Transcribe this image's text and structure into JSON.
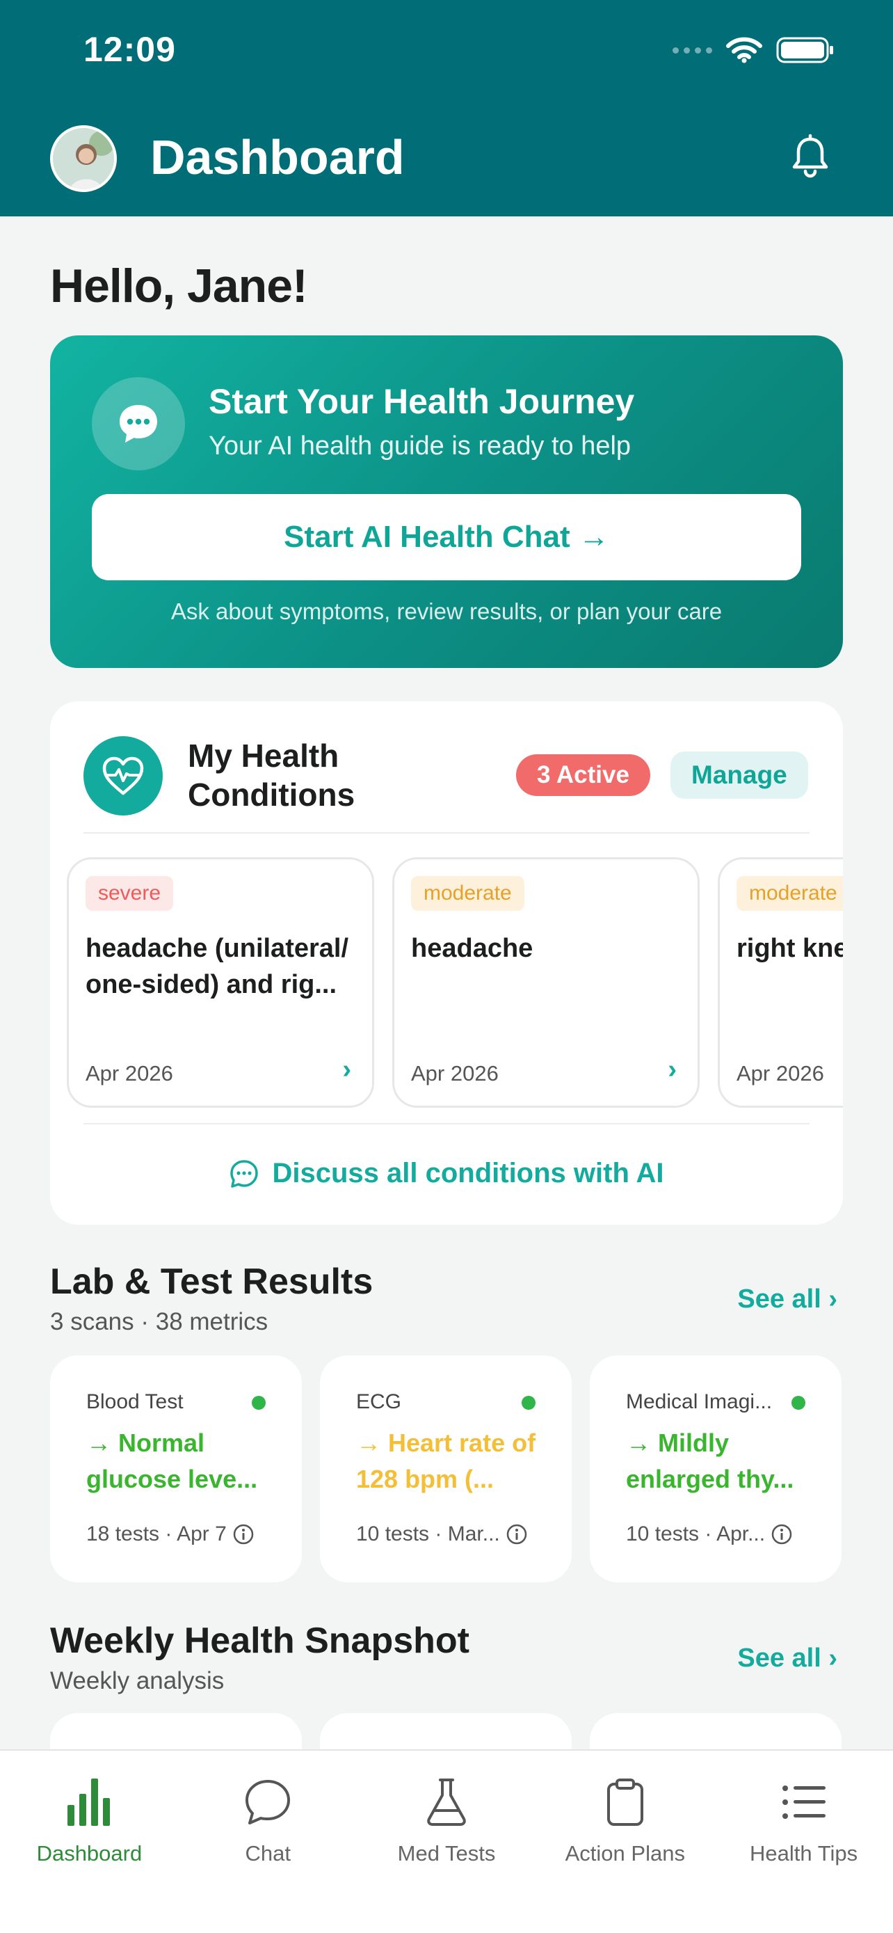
{
  "status_bar": {
    "time": "12:09"
  },
  "header": {
    "title": "Dashboard"
  },
  "greeting": "Hello, Jane!",
  "hero": {
    "title": "Start Your Health Journey",
    "subtitle": "Your AI health guide is ready to help",
    "button_label": "Start AI Health Chat →",
    "note": "Ask about symptoms, review results, or plan your care"
  },
  "conditions": {
    "title": "My Health Conditions",
    "active_badge": "3 Active",
    "manage_label": "Manage",
    "items": [
      {
        "severity": "severe",
        "name": "headache (unilateral/ one-sided) and rig...",
        "date": "Apr 2026"
      },
      {
        "severity": "moderate",
        "name": "headache",
        "date": "Apr 2026"
      },
      {
        "severity": "moderate",
        "name": "right knee",
        "date": "Apr 2026"
      }
    ],
    "discuss_label": "Discuss all conditions with AI"
  },
  "labs": {
    "title": "Lab & Test Results",
    "subtitle": "3 scans · 38 metrics",
    "see_all": "See all",
    "items": [
      {
        "category": "Blood Test",
        "result": "→ Normal glucose leve...",
        "meta": "18 tests · Apr 7",
        "color": "#3ab52e"
      },
      {
        "category": "ECG",
        "result": "→ Heart rate of 128 bpm (...",
        "meta": "10 tests · Mar...",
        "color": "#f4bf36"
      },
      {
        "category": "Medical Imagi...",
        "result": "→ Mildly enlarged thy...",
        "meta": "10 tests · Apr...",
        "color": "#3ab52e"
      }
    ]
  },
  "snapshot": {
    "title": "Weekly Health Snapshot",
    "subtitle": "Weekly analysis",
    "see_all": "See all"
  },
  "tabbar": {
    "items": [
      {
        "label": "Dashboard",
        "icon": "bar-chart-icon",
        "active": true
      },
      {
        "label": "Chat",
        "icon": "chat-bubble-icon",
        "active": false
      },
      {
        "label": "Med Tests",
        "icon": "flask-icon",
        "active": false
      },
      {
        "label": "Action Plans",
        "icon": "clipboard-icon",
        "active": false
      },
      {
        "label": "Health Tips",
        "icon": "list-icon",
        "active": false
      }
    ]
  },
  "colors": {
    "header_bg": "#016e77",
    "accent": "#12ab9d",
    "severe": "#ef5a5a",
    "moderate": "#e5a129",
    "active_tab": "#2e8b3a"
  }
}
